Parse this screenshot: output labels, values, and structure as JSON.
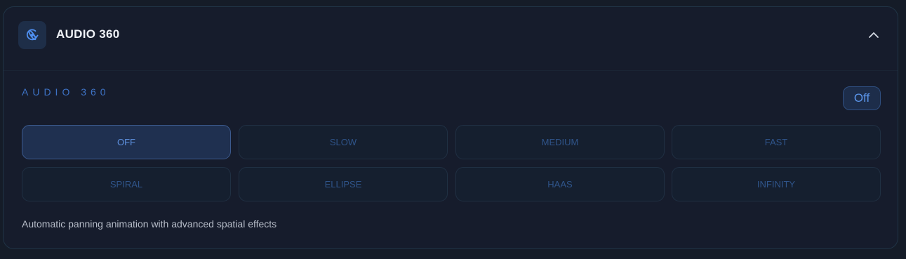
{
  "header": {
    "title": "AUDIO 360",
    "icon": "audio-360-icon",
    "collapse_icon": "chevron-up-icon"
  },
  "section": {
    "label": "AUDIO 360",
    "status": "Off"
  },
  "modes": [
    {
      "label": "OFF",
      "active": true
    },
    {
      "label": "SLOW",
      "active": false
    },
    {
      "label": "MEDIUM",
      "active": false
    },
    {
      "label": "FAST",
      "active": false
    },
    {
      "label": "SPIRAL",
      "active": false
    },
    {
      "label": "ELLIPSE",
      "active": false
    },
    {
      "label": "HAAS",
      "active": false
    },
    {
      "label": "INFINITY",
      "active": false
    }
  ],
  "description": "Automatic panning animation with advanced spatial effects",
  "colors": {
    "accent": "#3e73c6",
    "active_bg": "#1f3050",
    "panel_bg": "#161c2c"
  }
}
